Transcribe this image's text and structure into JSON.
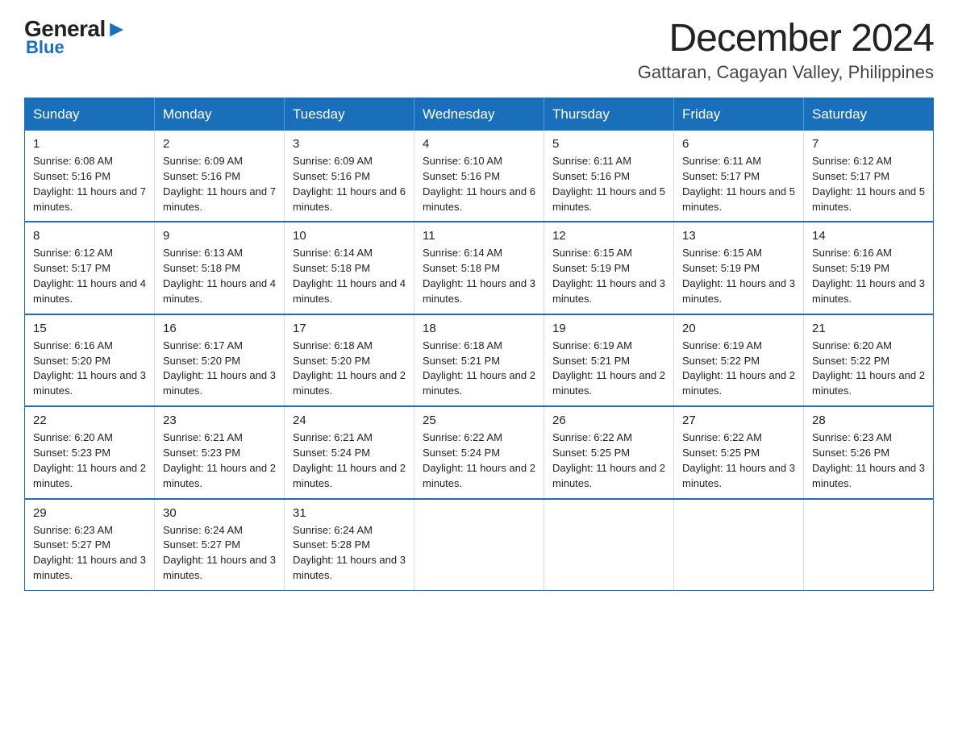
{
  "header": {
    "logo_general": "General",
    "logo_blue": "Blue",
    "main_title": "December 2024",
    "subtitle": "Gattaran, Cagayan Valley, Philippines"
  },
  "calendar": {
    "days_of_week": [
      "Sunday",
      "Monday",
      "Tuesday",
      "Wednesday",
      "Thursday",
      "Friday",
      "Saturday"
    ],
    "weeks": [
      [
        {
          "day": "1",
          "sunrise": "6:08 AM",
          "sunset": "5:16 PM",
          "daylight": "11 hours and 7 minutes."
        },
        {
          "day": "2",
          "sunrise": "6:09 AM",
          "sunset": "5:16 PM",
          "daylight": "11 hours and 7 minutes."
        },
        {
          "day": "3",
          "sunrise": "6:09 AM",
          "sunset": "5:16 PM",
          "daylight": "11 hours and 6 minutes."
        },
        {
          "day": "4",
          "sunrise": "6:10 AM",
          "sunset": "5:16 PM",
          "daylight": "11 hours and 6 minutes."
        },
        {
          "day": "5",
          "sunrise": "6:11 AM",
          "sunset": "5:16 PM",
          "daylight": "11 hours and 5 minutes."
        },
        {
          "day": "6",
          "sunrise": "6:11 AM",
          "sunset": "5:17 PM",
          "daylight": "11 hours and 5 minutes."
        },
        {
          "day": "7",
          "sunrise": "6:12 AM",
          "sunset": "5:17 PM",
          "daylight": "11 hours and 5 minutes."
        }
      ],
      [
        {
          "day": "8",
          "sunrise": "6:12 AM",
          "sunset": "5:17 PM",
          "daylight": "11 hours and 4 minutes."
        },
        {
          "day": "9",
          "sunrise": "6:13 AM",
          "sunset": "5:18 PM",
          "daylight": "11 hours and 4 minutes."
        },
        {
          "day": "10",
          "sunrise": "6:14 AM",
          "sunset": "5:18 PM",
          "daylight": "11 hours and 4 minutes."
        },
        {
          "day": "11",
          "sunrise": "6:14 AM",
          "sunset": "5:18 PM",
          "daylight": "11 hours and 3 minutes."
        },
        {
          "day": "12",
          "sunrise": "6:15 AM",
          "sunset": "5:19 PM",
          "daylight": "11 hours and 3 minutes."
        },
        {
          "day": "13",
          "sunrise": "6:15 AM",
          "sunset": "5:19 PM",
          "daylight": "11 hours and 3 minutes."
        },
        {
          "day": "14",
          "sunrise": "6:16 AM",
          "sunset": "5:19 PM",
          "daylight": "11 hours and 3 minutes."
        }
      ],
      [
        {
          "day": "15",
          "sunrise": "6:16 AM",
          "sunset": "5:20 PM",
          "daylight": "11 hours and 3 minutes."
        },
        {
          "day": "16",
          "sunrise": "6:17 AM",
          "sunset": "5:20 PM",
          "daylight": "11 hours and 3 minutes."
        },
        {
          "day": "17",
          "sunrise": "6:18 AM",
          "sunset": "5:20 PM",
          "daylight": "11 hours and 2 minutes."
        },
        {
          "day": "18",
          "sunrise": "6:18 AM",
          "sunset": "5:21 PM",
          "daylight": "11 hours and 2 minutes."
        },
        {
          "day": "19",
          "sunrise": "6:19 AM",
          "sunset": "5:21 PM",
          "daylight": "11 hours and 2 minutes."
        },
        {
          "day": "20",
          "sunrise": "6:19 AM",
          "sunset": "5:22 PM",
          "daylight": "11 hours and 2 minutes."
        },
        {
          "day": "21",
          "sunrise": "6:20 AM",
          "sunset": "5:22 PM",
          "daylight": "11 hours and 2 minutes."
        }
      ],
      [
        {
          "day": "22",
          "sunrise": "6:20 AM",
          "sunset": "5:23 PM",
          "daylight": "11 hours and 2 minutes."
        },
        {
          "day": "23",
          "sunrise": "6:21 AM",
          "sunset": "5:23 PM",
          "daylight": "11 hours and 2 minutes."
        },
        {
          "day": "24",
          "sunrise": "6:21 AM",
          "sunset": "5:24 PM",
          "daylight": "11 hours and 2 minutes."
        },
        {
          "day": "25",
          "sunrise": "6:22 AM",
          "sunset": "5:24 PM",
          "daylight": "11 hours and 2 minutes."
        },
        {
          "day": "26",
          "sunrise": "6:22 AM",
          "sunset": "5:25 PM",
          "daylight": "11 hours and 2 minutes."
        },
        {
          "day": "27",
          "sunrise": "6:22 AM",
          "sunset": "5:25 PM",
          "daylight": "11 hours and 3 minutes."
        },
        {
          "day": "28",
          "sunrise": "6:23 AM",
          "sunset": "5:26 PM",
          "daylight": "11 hours and 3 minutes."
        }
      ],
      [
        {
          "day": "29",
          "sunrise": "6:23 AM",
          "sunset": "5:27 PM",
          "daylight": "11 hours and 3 minutes."
        },
        {
          "day": "30",
          "sunrise": "6:24 AM",
          "sunset": "5:27 PM",
          "daylight": "11 hours and 3 minutes."
        },
        {
          "day": "31",
          "sunrise": "6:24 AM",
          "sunset": "5:28 PM",
          "daylight": "11 hours and 3 minutes."
        },
        null,
        null,
        null,
        null
      ]
    ]
  }
}
